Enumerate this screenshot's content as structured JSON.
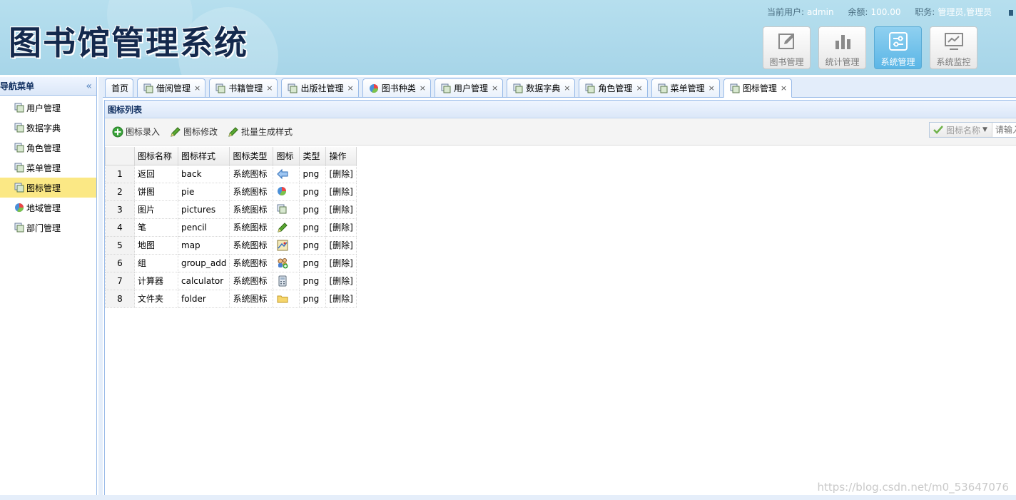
{
  "header": {
    "app_title": "图书馆管理系统",
    "user_label": "当前用户:",
    "user_value": "admin",
    "balance_label": "余额:",
    "balance_value": "100.00",
    "role_label": "职务:",
    "role_value": "管理员,管理员",
    "nav": [
      {
        "label": "图书管理",
        "icon": "edit-icon",
        "active": false
      },
      {
        "label": "统计管理",
        "icon": "bar-chart-icon",
        "active": false
      },
      {
        "label": "系统管理",
        "icon": "settings-sliders-icon",
        "active": true
      },
      {
        "label": "系统监控",
        "icon": "monitor-icon",
        "active": false
      }
    ]
  },
  "sidebar": {
    "title": "导航菜单",
    "collapse_glyph": "«",
    "items": [
      {
        "label": "用户管理",
        "icon": "pictures-icon"
      },
      {
        "label": "数据字典",
        "icon": "pictures-icon"
      },
      {
        "label": "角色管理",
        "icon": "pictures-icon"
      },
      {
        "label": "菜单管理",
        "icon": "pictures-icon"
      },
      {
        "label": "图标管理",
        "icon": "pictures-icon",
        "active": true
      },
      {
        "label": "地域管理",
        "icon": "pie-icon"
      },
      {
        "label": "部门管理",
        "icon": "pictures-icon"
      }
    ]
  },
  "tabs": [
    {
      "label": "首页",
      "closable": false
    },
    {
      "label": "借阅管理",
      "closable": true,
      "icon": "pictures-icon"
    },
    {
      "label": "书籍管理",
      "closable": true,
      "icon": "pictures-icon"
    },
    {
      "label": "出版社管理",
      "closable": true,
      "icon": "pictures-icon"
    },
    {
      "label": "图书种类",
      "closable": true,
      "icon": "pie-icon"
    },
    {
      "label": "用户管理",
      "closable": true,
      "icon": "pictures-icon"
    },
    {
      "label": "数据字典",
      "closable": true,
      "icon": "pictures-icon"
    },
    {
      "label": "角色管理",
      "closable": true,
      "icon": "pictures-icon"
    },
    {
      "label": "菜单管理",
      "closable": true,
      "icon": "pictures-icon"
    },
    {
      "label": "图标管理",
      "closable": true,
      "icon": "pictures-icon",
      "active": true
    }
  ],
  "tab_close_glyph": "×",
  "panel": {
    "title": "图标列表",
    "toolbar": {
      "add_label": "图标录入",
      "edit_label": "图标修改",
      "batch_label": "批量生成样式"
    },
    "search": {
      "field_label": "图标名称",
      "placeholder": "请输入"
    }
  },
  "grid": {
    "columns": [
      "图标名称",
      "图标样式",
      "图标类型",
      "图标",
      "类型",
      "操作"
    ],
    "rows": [
      {
        "no": "1",
        "name": "返回",
        "style": "back",
        "kind": "系统图标",
        "icon": "back-arrow-icon",
        "type": "png",
        "op": "[删除]"
      },
      {
        "no": "2",
        "name": "饼图",
        "style": "pie",
        "kind": "系统图标",
        "icon": "pie-icon",
        "type": "png",
        "op": "[删除]"
      },
      {
        "no": "3",
        "name": "图片",
        "style": "pictures",
        "kind": "系统图标",
        "icon": "pictures-icon",
        "type": "png",
        "op": "[删除]"
      },
      {
        "no": "4",
        "name": "笔",
        "style": "pencil",
        "kind": "系统图标",
        "icon": "pencil-icon",
        "type": "png",
        "op": "[删除]"
      },
      {
        "no": "5",
        "name": "地图",
        "style": "map",
        "kind": "系统图标",
        "icon": "map-icon",
        "type": "png",
        "op": "[删除]"
      },
      {
        "no": "6",
        "name": "组",
        "style": "group_add",
        "kind": "系统图标",
        "icon": "group-add-icon",
        "type": "png",
        "op": "[删除]"
      },
      {
        "no": "7",
        "name": "计算器",
        "style": "calculator",
        "kind": "系统图标",
        "icon": "calculator-icon",
        "type": "png",
        "op": "[删除]"
      },
      {
        "no": "8",
        "name": "文件夹",
        "style": "folder",
        "kind": "系统图标",
        "icon": "folder-icon",
        "type": "png",
        "op": "[删除]"
      }
    ]
  },
  "watermark": "https://blog.csdn.net/m0_53647076",
  "colors": {
    "header_bg": "#add9eb",
    "title_color": "#14294d",
    "active_nav": "#5bb6e6",
    "active_side": "#fbe885",
    "border_blue": "#99bbe8"
  }
}
